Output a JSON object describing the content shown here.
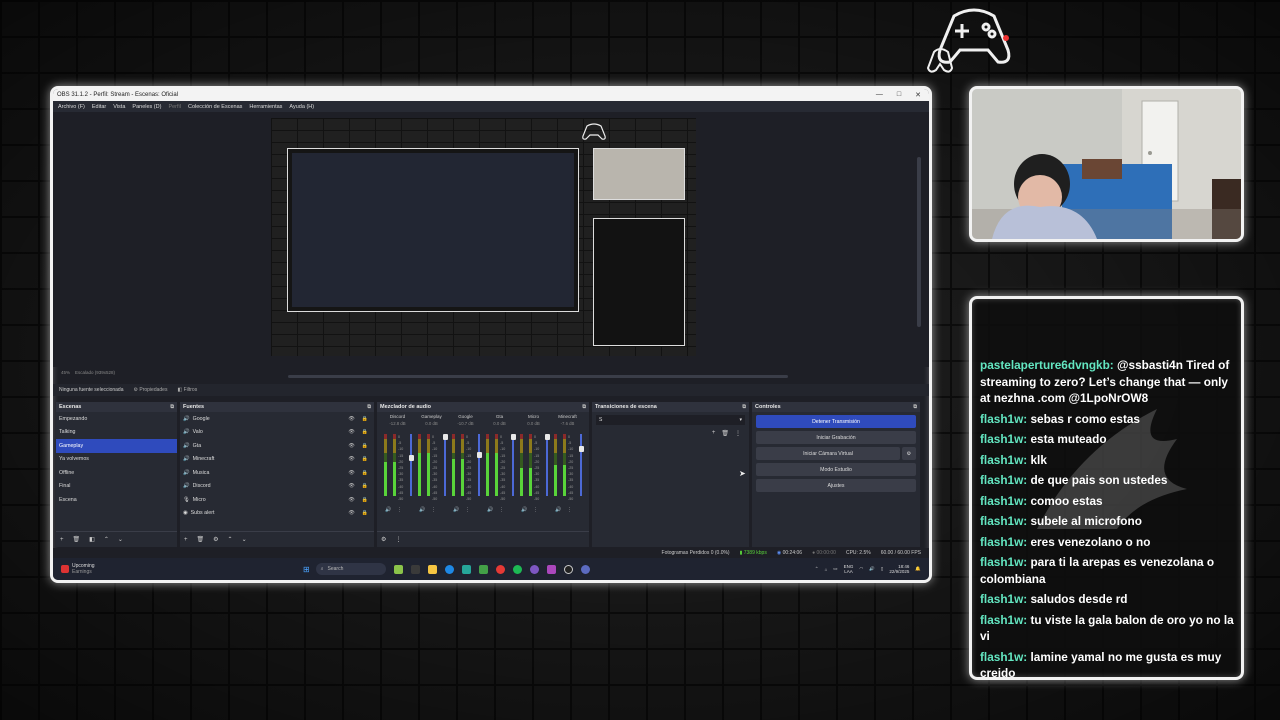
{
  "obs": {
    "title": "OBS 31.1.2 - Perfil: Stream - Escenas: Oficial",
    "window_controls": [
      "—",
      "□",
      "✕"
    ],
    "menu": [
      "Archivo (F)",
      "Editar",
      "Vista",
      "Paneles (D)",
      "Perfil",
      "Colección de Escenas",
      "Herramientas",
      "Ayuda (H)"
    ],
    "zoom_text": "45%",
    "scale_text": "Escalado (939x528)",
    "no_source": "Ninguna fuente seleccionada",
    "properties": "Propiedades",
    "filters": "Filtros",
    "scenes": {
      "header": "Escenas",
      "items": [
        "Empezando",
        "Talking",
        "Gameplay",
        "Ya volvemos",
        "Offline",
        "Final",
        "Escena"
      ],
      "selected": "Gameplay"
    },
    "sources": {
      "header": "Fuentes",
      "items": [
        "Google",
        "Valo",
        "Gta",
        "Minecraft",
        "Musica",
        "Discord",
        "Micro",
        "Subs alert"
      ]
    },
    "mixer": {
      "header": "Mezclador de audio",
      "channels": [
        {
          "name": "Discord",
          "db": "-12.8 dB",
          "level": 0.55,
          "fader": 0.62
        },
        {
          "name": "Gameplay",
          "db": "0.0 dB",
          "level": 0.75,
          "fader": 1.0
        },
        {
          "name": "Google",
          "db": "-10.7 dB",
          "level": 0.6,
          "fader": 0.68
        },
        {
          "name": "Gta",
          "db": "0.0 dB",
          "level": 0.7,
          "fader": 1.0
        },
        {
          "name": "Micro",
          "db": "0.0 dB",
          "level": 0.45,
          "fader": 1.0
        },
        {
          "name": "Minecraft",
          "db": "-7.6 dB",
          "level": 0.5,
          "fader": 0.78
        }
      ],
      "ticks": [
        "0",
        "-5",
        "-10",
        "-15",
        "-20",
        "-25",
        "-30",
        "-35",
        "-40",
        "-45",
        "-50"
      ]
    },
    "transitions": {
      "header": "Transiciones de escena",
      "value": "S"
    },
    "controls": {
      "header": "Controles",
      "buttons": [
        "Detener Transmisión",
        "Iniciar Grabación",
        "Iniciar Cámara Virtual",
        "Modo Estudio",
        "Ajustes"
      ]
    },
    "status": {
      "frames_lost": "Fotogramas Perdidos 0 (0.0%)",
      "bitrate": "7389 kbps",
      "live_time": "00:24:06",
      "rec_time": "00:00:00",
      "cpu": "CPU: 2.5%",
      "fps": "60.00 / 60.00 FPS"
    },
    "taskbar": {
      "weather_title": "Upcoming",
      "weather_sub": "Earnings",
      "search": "Search",
      "lang": "ENG",
      "lang_sub": "LAA",
      "time": "18:46",
      "date": "22/9/2025"
    }
  },
  "chat": {
    "messages": [
      {
        "user": "pastelaperture6dvngkb:",
        "text": " @ssbasti4n Tired of streaming to zero? Let’s change that — only at nezhna .com @1LpoNrOW8"
      },
      {
        "user": "flash1w:",
        "text": " sebas r como estas"
      },
      {
        "user": "flash1w:",
        "text": " esta muteado"
      },
      {
        "user": "flash1w:",
        "text": " klk"
      },
      {
        "user": "flash1w:",
        "text": " de que pais son ustedes"
      },
      {
        "user": "flash1w:",
        "text": " comoo estas"
      },
      {
        "user": "flash1w:",
        "text": " subele al microfono"
      },
      {
        "user": "flash1w:",
        "text": " eres venezolano o no"
      },
      {
        "user": "flash1w:",
        "text": " para ti la arepas es venezolana o colombiana"
      },
      {
        "user": "flash1w:",
        "text": " saludos desde rd"
      },
      {
        "user": "flash1w:",
        "text": " tu viste la gala balon de oro yo no la vi"
      },
      {
        "user": "flash1w:",
        "text": " lamine yamal no me gusta es muy creido"
      }
    ]
  },
  "colors": {
    "chat_user": "#63e6c1",
    "obs_accent": "#2f4bbd",
    "frame": "#f2f2f2"
  }
}
